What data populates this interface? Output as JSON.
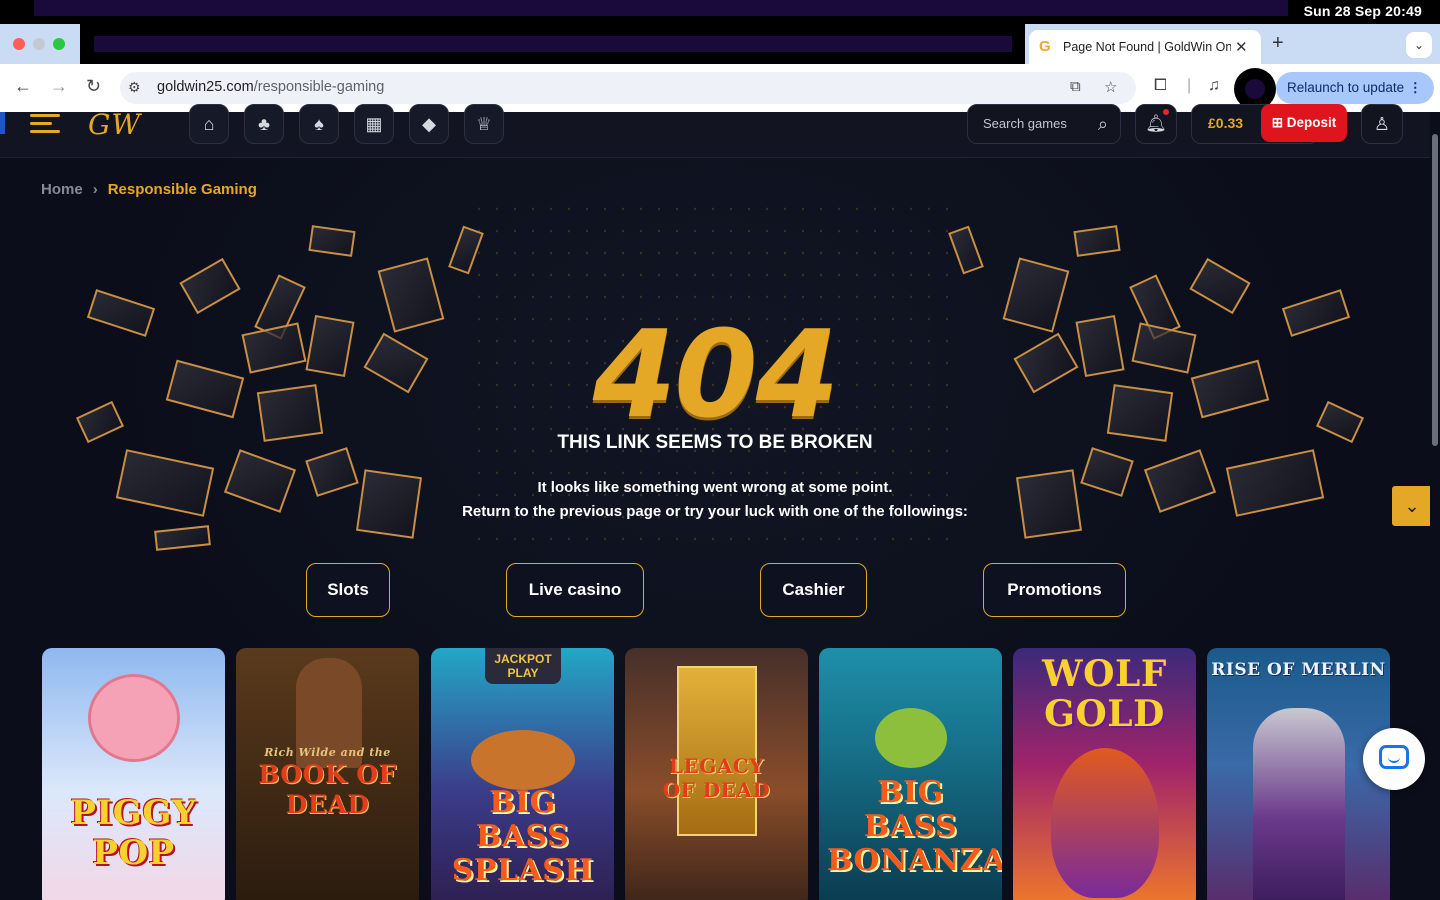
{
  "os": {
    "clock": "Sun 28 Sep  20:49"
  },
  "browser": {
    "tab_title": "Page Not Found | GoldWin Online Casino",
    "url_domain": "goldwin25.com",
    "url_path": "/responsible-gaming",
    "relaunch_label": "Relaunch to update"
  },
  "header": {
    "logo": "GW",
    "search_placeholder": "Search games",
    "balance": "£0.33",
    "deposit_label": "Deposit",
    "category_icons": [
      "home-icon",
      "cherries-icon",
      "spade-icon",
      "gift-icon",
      "diamond-icon",
      "trophy-icon"
    ]
  },
  "breadcrumb": {
    "home": "Home",
    "current": "Responsible Gaming"
  },
  "error": {
    "code": "404",
    "headline": "THIS LINK SEEMS TO BE BROKEN",
    "line1": "It looks like something went wrong at some point.",
    "line2": "Return to the previous page or try your luck with one of the followings:"
  },
  "links": [
    "Slots",
    "Live casino",
    "Cashier",
    "Promotions"
  ],
  "games": [
    {
      "title": "PIGGY POP"
    },
    {
      "title": "BOOK OF DEAD",
      "subtitle": "Rich Wilde and the"
    },
    {
      "title": "BIG BASS SPLASH",
      "badge": "JACKPOT PLAY"
    },
    {
      "title": "LEGACY OF DEAD"
    },
    {
      "title": "BIG BASS BONANZA"
    },
    {
      "title": "WOLF GOLD"
    },
    {
      "title": "RISE OF MERLIN"
    }
  ],
  "colors": {
    "accent": "#e5a826",
    "deposit": "#e0141e",
    "background": "#0b0e1a"
  }
}
